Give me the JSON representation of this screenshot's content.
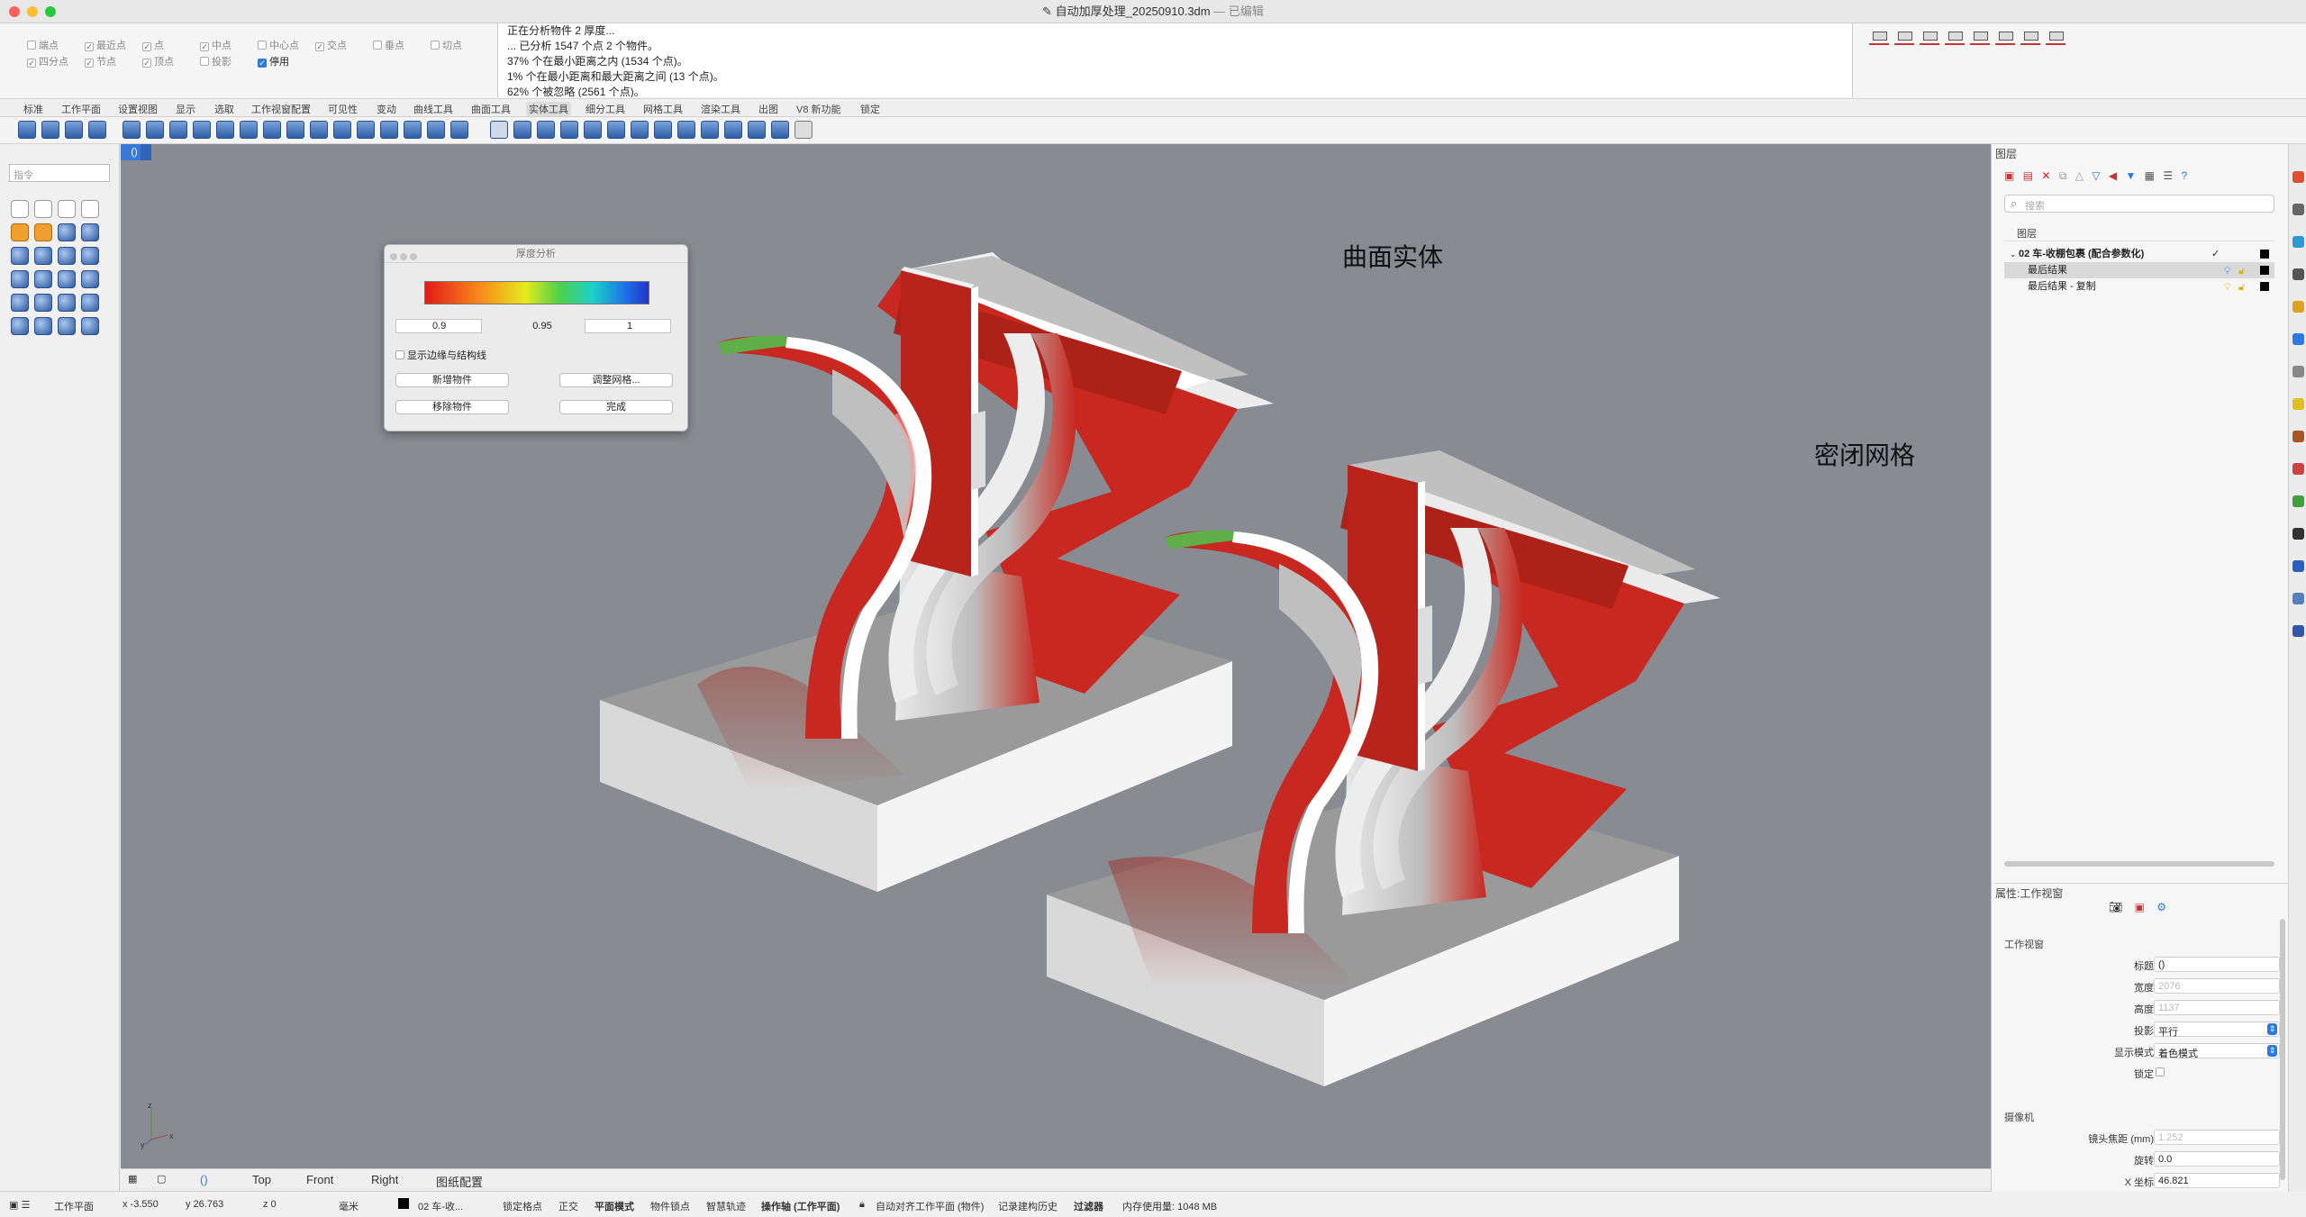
{
  "window": {
    "title": "自动加厚处理_20250910.3dm",
    "status": "— 已编辑"
  },
  "osnap": [
    {
      "label": "端点",
      "on": false
    },
    {
      "label": "最近点",
      "on": false
    },
    {
      "label": "点",
      "on": false
    },
    {
      "label": "中点",
      "on": false
    },
    {
      "label": "中心点",
      "on": false
    },
    {
      "label": "交点",
      "on": false
    },
    {
      "label": "垂点",
      "on": false
    },
    {
      "label": "切点",
      "on": false
    },
    {
      "label": "四分点",
      "on": false
    },
    {
      "label": "节点",
      "on": false
    },
    {
      "label": "顶点",
      "on": false
    },
    {
      "label": "投影",
      "on": false
    },
    {
      "label": "停用",
      "on": true
    }
  ],
  "command_history": [
    "正在分析物件 2 厚度...",
    "... 已分析 1547 个点 2 个物件。",
    "37% 个在最小距离之内 (1534 个点)。",
    "1% 个在最小距离和最大距离之间 (13 个点)。",
    "62% 个被忽略 (2561 个点)。"
  ],
  "tabs": [
    "标准",
    "工作平面",
    "设置视图",
    "显示",
    "选取",
    "工作视窗配置",
    "可见性",
    "变动",
    "曲线工具",
    "曲面工具",
    "实体工具",
    "细分工具",
    "网格工具",
    "渲染工具",
    "出图",
    "V8 新功能",
    "锁定"
  ],
  "active_tab": "实体工具",
  "command_placeholder": "指令",
  "viewport": {
    "label": "()",
    "annotation_solid": "曲面实体",
    "annotation_mesh": "密闭网格",
    "axis_x": "x",
    "axis_y": "y",
    "axis_z": "z"
  },
  "thickness_dialog": {
    "title": "厚度分析",
    "min": "0.9",
    "mid": "0.95",
    "max": "1",
    "show_edges_label": "显示边缘与结构线",
    "add_button": "新增物件",
    "adjust_mesh_button": "调整网格...",
    "remove_button": "移除物件",
    "done_button": "完成"
  },
  "viewport_tabs": [
    "()",
    "Top",
    "Front",
    "Right",
    "图纸配置"
  ],
  "status": {
    "cplane": "工作平面",
    "x": "x -3.550",
    "y": "y 26.763",
    "z": "z 0",
    "units": "毫米",
    "layer": "02 车-收...",
    "items": [
      "锁定格点",
      "正交",
      "平面模式",
      "物件锁点",
      "智慧轨迹",
      "操作轴 (工作平面)",
      "自动对齐工作平面 (物件)",
      "记录建构历史",
      "过滤器",
      "内存使用量: 1048 MB"
    ]
  },
  "layers_panel": {
    "title": "图层",
    "search_placeholder": "搜索",
    "column_header": "图层",
    "rows": [
      {
        "name": "02 车-收棚包裹 (配合参数化)",
        "current": true
      },
      {
        "name": "最后结果",
        "selected": true
      },
      {
        "name": "最后结果 - 复制"
      }
    ]
  },
  "properties_panel": {
    "title": "属性:工作视窗",
    "section_viewport": "工作视窗",
    "fields": [
      {
        "label": "标题",
        "value": "()"
      },
      {
        "label": "宽度",
        "value": "2076"
      },
      {
        "label": "高度",
        "value": "1137"
      },
      {
        "label": "投影",
        "value": "平行"
      },
      {
        "label": "显示模式",
        "value": "着色模式"
      },
      {
        "label": "锁定",
        "value": ""
      }
    ],
    "section_camera": "摄像机",
    "camera_fields": [
      {
        "label": "镜头焦距 (mm)",
        "value": "1.252"
      },
      {
        "label": "旋转",
        "value": "0.0"
      },
      {
        "label": "X 坐标",
        "value": "46.821"
      }
    ]
  },
  "colors": {
    "accent": "#2a7ae2",
    "model_red": "#c8281f",
    "viewport_bg": "#888b92"
  }
}
